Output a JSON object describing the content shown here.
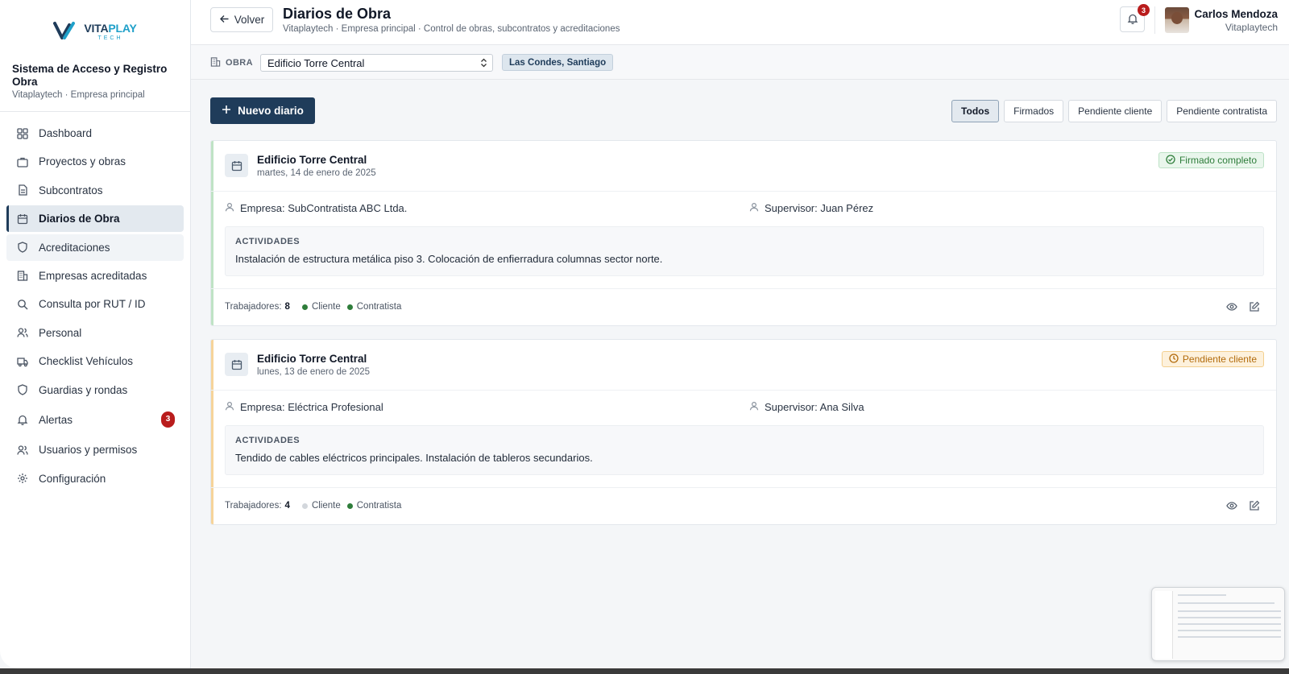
{
  "brand": {
    "logo_primary": "VITA",
    "logo_secondary": "PLAY",
    "logo_sub": "TECH",
    "colors": {
      "navy": "#1f3c5a",
      "cyan": "#1fa0c9"
    }
  },
  "sidebar": {
    "system_title": "Sistema de Acceso y Registro Obra",
    "system_sub": "Vitaplaytech · Empresa principal",
    "items": [
      {
        "label": "Dashboard",
        "icon": "grid-icon"
      },
      {
        "label": "Proyectos y obras",
        "icon": "briefcase-icon"
      },
      {
        "label": "Subcontratos",
        "icon": "document-icon"
      },
      {
        "label": "Diarios de Obra",
        "icon": "calendar-icon",
        "active": true
      },
      {
        "label": "Acreditaciones",
        "icon": "shield-icon"
      },
      {
        "label": "Empresas acreditadas",
        "icon": "building-icon"
      },
      {
        "label": "Consulta por RUT / ID",
        "icon": "search-icon"
      },
      {
        "label": "Personal",
        "icon": "users-icon"
      },
      {
        "label": "Checklist Vehículos",
        "icon": "truck-icon"
      },
      {
        "label": "Guardias y rondas",
        "icon": "shield-icon"
      },
      {
        "label": "Alertas",
        "icon": "bell-icon",
        "badge": "3"
      },
      {
        "label": "Usuarios y permisos",
        "icon": "users-icon"
      },
      {
        "label": "Configuración",
        "icon": "gear-icon"
      }
    ]
  },
  "header": {
    "back_label": "Volver",
    "title": "Diarios de Obra",
    "subtitle": "Vitaplaytech · Empresa principal · Control de obras, subcontratos y acreditaciones",
    "notifications": "3",
    "user_name": "Carlos Mendoza",
    "user_org": "Vitaplaytech"
  },
  "obra_bar": {
    "label": "OBRA",
    "selected": "Edificio Torre Central",
    "location": "Las Condes, Santiago"
  },
  "toolbar": {
    "new_label": "Nuevo diario",
    "filters": [
      "Todos",
      "Firmados",
      "Pendiente cliente",
      "Pendiente contratista"
    ],
    "active_filter": "Todos"
  },
  "diaries": [
    {
      "title": "Edificio Torre Central",
      "date": "martes, 14 de enero de 2025",
      "status": "Firmado completo",
      "status_type": "ok",
      "empresa": "Empresa: SubContratista ABC Ltda.",
      "supervisor": "Supervisor: Juan Pérez",
      "activities_label": "ACTIVIDADES",
      "activities": "Instalación de estructura metálica piso 3. Colocación de enfierradura columnas sector norte.",
      "workers_label": "Trabajadores:",
      "workers": "8",
      "client_label": "Cliente",
      "client_signed": true,
      "contractor_label": "Contratista",
      "contractor_signed": true
    },
    {
      "title": "Edificio Torre Central",
      "date": "lunes, 13 de enero de 2025",
      "status": "Pendiente cliente",
      "status_type": "warn",
      "empresa": "Empresa: Eléctrica Profesional",
      "supervisor": "Supervisor: Ana Silva",
      "activities_label": "ACTIVIDADES",
      "activities": "Tendido de cables eléctricos principales. Instalación de tableros secundarios.",
      "workers_label": "Trabajadores:",
      "workers": "4",
      "client_label": "Cliente",
      "client_signed": false,
      "contractor_label": "Contratista",
      "contractor_signed": true
    }
  ]
}
